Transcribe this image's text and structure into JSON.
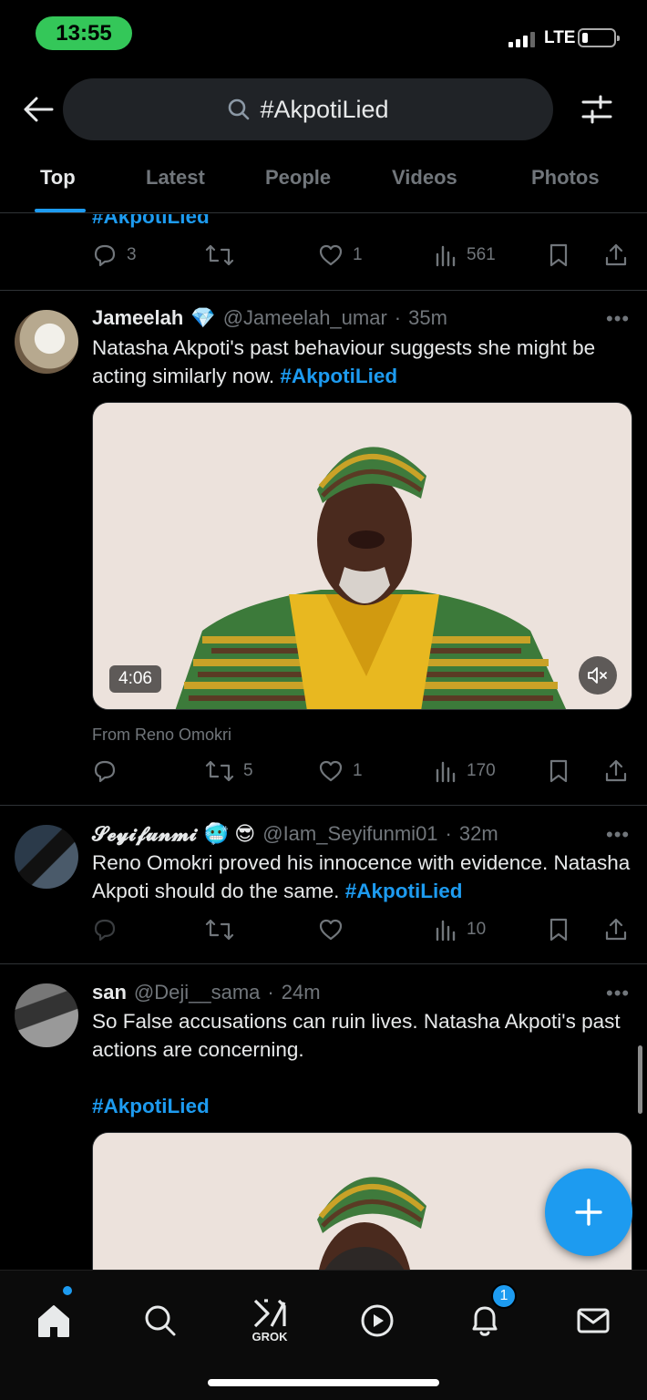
{
  "status_bar": {
    "time": "13:55",
    "network": "LTE"
  },
  "search": {
    "query": "#AkpotiLied"
  },
  "tabs": [
    {
      "label": "Top",
      "active": true
    },
    {
      "label": "Latest"
    },
    {
      "label": "People"
    },
    {
      "label": "Videos"
    },
    {
      "label": "Photos"
    }
  ],
  "partial_post": {
    "hashtag": "#AkpotiLied",
    "replies": "3",
    "reposts": "",
    "likes": "1",
    "views": "561"
  },
  "posts": [
    {
      "name": "Jameelah",
      "badge": "💎",
      "handle": "@Jameelah_umar",
      "time": "35m",
      "text": "Natasha Akpoti's past behaviour suggests she might be acting similarly now.",
      "hashtag": "#AkpotiLied",
      "video_duration": "4:06",
      "from": "From Reno Omokri",
      "replies": "",
      "reposts": "5",
      "likes": "1",
      "views": "170"
    },
    {
      "name": "𝓢𝓮𝔂𝓲𝓯𝓾𝓷𝓶𝓲",
      "badge": "🥶 😎",
      "handle": "@Iam_Seyifunmi01",
      "time": "32m",
      "text": "Reno Omokri proved his innocence with evidence. Natasha Akpoti should do the same.",
      "hashtag": "#AkpotiLied",
      "replies": "",
      "reposts": "",
      "likes": "",
      "views": "10"
    },
    {
      "name": "san",
      "handle": "@Deji__sama",
      "time": "24m",
      "text": "So False accusations can ruin lives. Natasha Akpoti's past actions are concerning.",
      "hashtag": "#AkpotiLied"
    }
  ],
  "nav": {
    "grok_label": "GROK",
    "notif_count": "1"
  },
  "colors": {
    "accent": "#1d9bf0",
    "background": "#000000",
    "muted": "#71767b",
    "status_green": "#34c759"
  }
}
